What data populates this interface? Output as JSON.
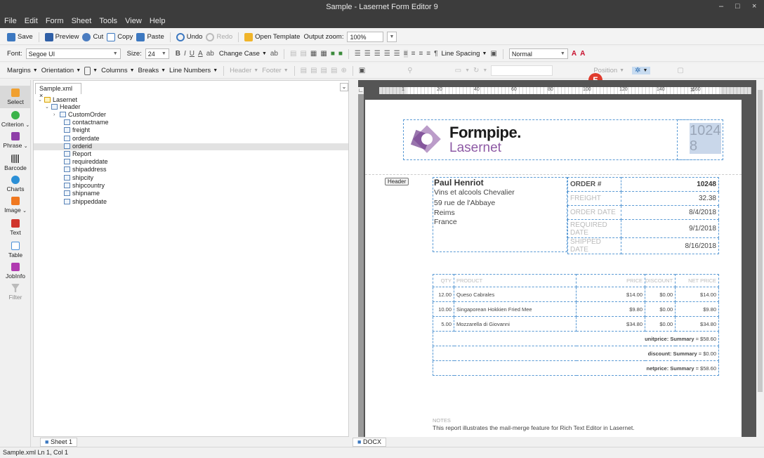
{
  "window": {
    "title": "Sample - Lasernet Form Editor 9",
    "controls": [
      "–",
      "□",
      "×"
    ]
  },
  "menu": [
    "File",
    "Edit",
    "Form",
    "Sheet",
    "Tools",
    "View",
    "Help"
  ],
  "toolbar1": {
    "save": "Save",
    "preview": "Preview",
    "cut": "Cut",
    "copy": "Copy",
    "paste": "Paste",
    "undo": "Undo",
    "redo": "Redo",
    "open_template": "Open Template",
    "output_zoom_label": "Output zoom:",
    "output_zoom_value": "100%"
  },
  "toolbar2": {
    "font_label": "Font:",
    "font_value": "Segoe UI",
    "size_label": "Size:",
    "size_value": "24",
    "change_case": "Change Case",
    "line_spacing": "Line Spacing",
    "style_value": "Normal"
  },
  "toolbar3": {
    "margins": "Margins",
    "orientation": "Orientation",
    "columns": "Columns",
    "breaks": "Breaks",
    "line_numbers": "Line Numbers",
    "header": "Header",
    "footer": "Footer",
    "position": "Position"
  },
  "toolbox": [
    {
      "label": "Select",
      "icon": "select-icon",
      "color": "#f0a030"
    },
    {
      "label": "Criterion",
      "icon": "criterion-icon",
      "color": "#3bb34a"
    },
    {
      "label": "Phrase",
      "icon": "phrase-icon",
      "color": "#8e3ea8"
    },
    {
      "label": "Barcode",
      "icon": "barcode-icon",
      "color": "#555555"
    },
    {
      "label": "Charts",
      "icon": "charts-icon",
      "color": "#2b8fd6"
    },
    {
      "label": "Image",
      "icon": "image-icon",
      "color": "#f07820"
    },
    {
      "label": "Text",
      "icon": "text-icon",
      "color": "#d0342c"
    },
    {
      "label": "Table",
      "icon": "table-icon",
      "color": "#4a90d9"
    },
    {
      "label": "JobInfo",
      "icon": "jobinfo-icon",
      "color": "#b03ab0"
    },
    {
      "label": "Filter",
      "icon": "filter-icon",
      "color": "#aaaaaa"
    }
  ],
  "tree": {
    "tab": "Sample.xml",
    "root": "Lasernet",
    "header": "Header",
    "fields": [
      "CustomOrder",
      "contactname",
      "freight",
      "orderdate",
      "orderid",
      "Report",
      "requireddate",
      "shipaddress",
      "shipcity",
      "shipcountry",
      "shipname",
      "shippeddate"
    ],
    "selected": "orderid"
  },
  "sheet_tab": "Sheet 1",
  "doc_tab": "DOCX",
  "status": "Sample.xml  Ln 1, Col 1",
  "ruler_marks": [
    "1",
    "20",
    "40",
    "60",
    "80",
    "100",
    "120",
    "140",
    "160"
  ],
  "badge": "5",
  "document": {
    "logo_top": "Formpipe.",
    "logo_bottom": "Lasernet",
    "order_number_display": [
      "1024",
      "8"
    ],
    "header_label": "Header",
    "customer": {
      "name": "Paul Henriot",
      "lines": [
        "Vins et alcools Chevalier",
        "59 rue de l'Abbaye",
        "Reims",
        "France"
      ]
    },
    "order_rows": [
      {
        "label": "ORDER #",
        "value": "10248"
      },
      {
        "label": "FREIGHT",
        "value": "32.38"
      },
      {
        "label": "ORDER DATE",
        "value": "8/4/2018"
      },
      {
        "label": "REQUIRED DATE",
        "value": "9/1/2018"
      },
      {
        "label": "SHIPPED DATE",
        "value": "8/16/2018"
      }
    ],
    "items_header": [
      "QTY",
      "PRODUCT",
      "PRICE",
      "DISCOUNT",
      "NET PRICE"
    ],
    "items": [
      [
        "12.00",
        "Queso Cabrales",
        "$14.00",
        "$0.00",
        "$14.00"
      ],
      [
        "10.00",
        "Singaporean Hokkien Fried Mee",
        "$9.80",
        "$0.00",
        "$9.80"
      ],
      [
        "5.00",
        "Mozzarella di Giovanni",
        "$34.80",
        "$0.00",
        "$34.80"
      ]
    ],
    "summaries": [
      {
        "label": "unitprice: Summary",
        "value": " = $58.60"
      },
      {
        "label": "discount: Summary",
        "value": " = $0.00"
      },
      {
        "label": "netprice: Summary",
        "value": " = $58.60"
      }
    ],
    "notes_label": "NOTES",
    "notes_text": "This report illustrates the mail-merge feature for Rich Text Editor in Lasernet."
  },
  "colors": {
    "accent_purple": "#8e5aa5",
    "guide_blue": "#5b9bd5",
    "badge_red": "#e03b2d"
  }
}
